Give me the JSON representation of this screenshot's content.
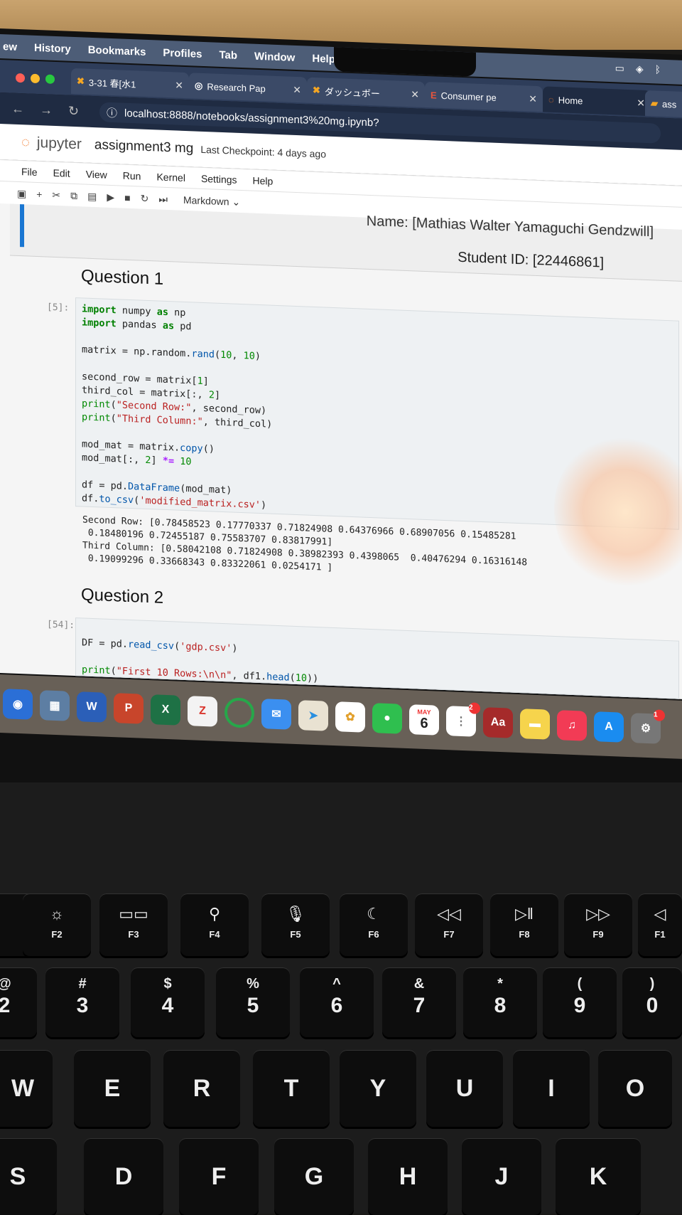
{
  "mac_menu": [
    "ew",
    "History",
    "Bookmarks",
    "Profiles",
    "Tab",
    "Window",
    "Help"
  ],
  "browser": {
    "tabs": [
      {
        "label": "3-31 春[水1",
        "icon": "x-brand-icon"
      },
      {
        "label": "Research Pap",
        "icon": "globe-icon"
      },
      {
        "label": "ダッシュボー",
        "icon": "x-brand-icon"
      },
      {
        "label": "Consumer pe",
        "icon": "e-brand-icon"
      },
      {
        "label": "Home",
        "icon": "jupyter-icon"
      },
      {
        "label": "ass",
        "icon": "folder-icon"
      }
    ],
    "url": "localhost:8888/notebooks/assignment3%20mg.ipynb?"
  },
  "jupyter": {
    "logo_text": "jupyter",
    "notebook_title": "assignment3 mg",
    "checkpoint": "Last Checkpoint: 4 days ago",
    "menu": [
      "File",
      "Edit",
      "View",
      "Run",
      "Kernel",
      "Settings",
      "Help"
    ],
    "cell_type": "Markdown"
  },
  "notebook": {
    "name_line": "Name: [Mathias Walter Yamaguchi Gendzwill]",
    "student_id": "Student ID: [22446861]",
    "q1_heading": "Question 1",
    "q1_prompt": "[5]:",
    "q1_output": "Second Row: [0.78458523 0.17770337 0.71824908 0.64376966 0.68907056 0.15485281\n 0.18480196 0.72455187 0.75583707 0.83817991]\nThird Column: [0.58042108 0.71824908 0.38982393 0.4398065  0.40476294 0.16316148\n 0.19099296 0.33668343 0.83322061 0.0254171 ]",
    "q2_heading": "Question 2",
    "q2_prompt": "[54]:"
  },
  "dock": {
    "calendar_month": "MAY",
    "calendar_day": "6",
    "reminders_badge": "2",
    "settings_badge": "1",
    "dictionary_label": "Aa"
  },
  "keyboard": {
    "fkeys": [
      "F2",
      "F3",
      "F4",
      "F5",
      "F6",
      "F7",
      "F8",
      "F9",
      "F1"
    ],
    "numkeys": [
      [
        "@",
        "2"
      ],
      [
        "#",
        "3"
      ],
      [
        "$",
        "4"
      ],
      [
        "%",
        "5"
      ],
      [
        "^",
        "6"
      ],
      [
        "&",
        "7"
      ],
      [
        "*",
        "8"
      ],
      [
        "(",
        "9"
      ],
      [
        ")",
        "0"
      ]
    ],
    "row_qwerty": [
      "W",
      "E",
      "R",
      "T",
      "Y",
      "U",
      "I",
      "O"
    ],
    "row_home": [
      "S",
      "D",
      "F",
      "G",
      "H",
      "J",
      "K"
    ]
  }
}
